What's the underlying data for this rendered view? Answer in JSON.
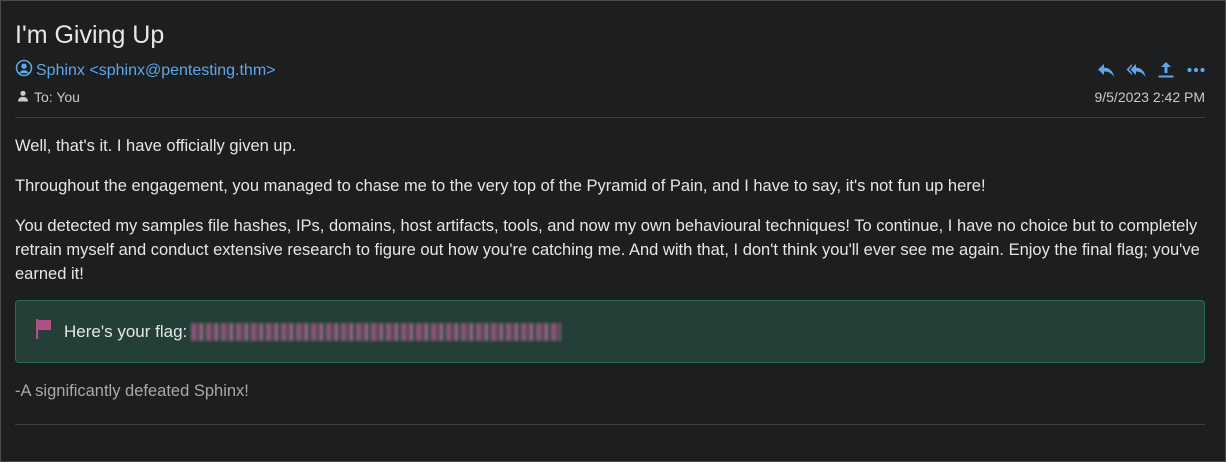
{
  "email": {
    "subject": "I'm Giving Up",
    "sender": "Sphinx <sphinx@pentesting.thm>",
    "recipient": "To: You",
    "date": "9/5/2023 2:42 PM",
    "actions": [
      {
        "icon": "reply-icon"
      },
      {
        "icon": "reply-all-icon"
      },
      {
        "icon": "forward-icon"
      },
      {
        "icon": "more-icon"
      }
    ],
    "body": [
      "Well, that's it. I have officially given up.",
      "Throughout the engagement, you managed to chase me to the very top of the Pyramid of Pain, and I have to say, it's not fun up here!",
      "You detected my samples file hashes, IPs, domains, host artifacts, tools, and now my own behavioural techniques! To continue, I have no choice but to completely retrain myself and conduct extensive research to figure out how you're catching me. And with that, I don't think you'll ever see me again. Enjoy the final flag; you've earned it!"
    ],
    "flag_label": "Here's your flag:",
    "signoff": "-A significantly defeated Sphinx!"
  },
  "colors": {
    "background": "#1d1e20",
    "link": "#5ea7ea",
    "flag_box": "#233f37",
    "flag_icon": "#b05085"
  }
}
